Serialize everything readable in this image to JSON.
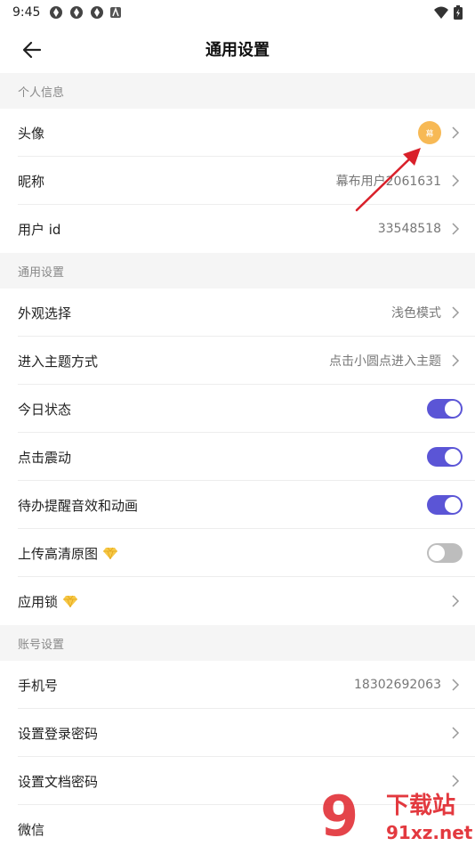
{
  "status_bar": {
    "time": "9:45"
  },
  "header": {
    "title": "通用设置"
  },
  "sections": {
    "personal": {
      "title": "个人信息",
      "avatar": {
        "label": "头像",
        "avatar_text": "幕"
      },
      "nickname": {
        "label": "昵称",
        "value": "幕布用户2061631"
      },
      "user_id": {
        "label": "用户 id",
        "value": "33548518"
      }
    },
    "general": {
      "title": "通用设置",
      "appearance": {
        "label": "外观选择",
        "value": "浅色模式"
      },
      "theme_entry": {
        "label": "进入主题方式",
        "value": "点击小圆点进入主题"
      },
      "today_status": {
        "label": "今日状态",
        "enabled": true
      },
      "tap_vibration": {
        "label": "点击震动",
        "enabled": true
      },
      "todo_reminder": {
        "label": "待办提醒音效和动画",
        "enabled": true
      },
      "upload_hd": {
        "label": "上传高清原图",
        "enabled": false,
        "premium_icon": "diamond-icon"
      },
      "app_lock": {
        "label": "应用锁",
        "premium_icon": "diamond-icon"
      }
    },
    "account": {
      "title": "账号设置",
      "phone": {
        "label": "手机号",
        "value": "18302692063"
      },
      "login_password": {
        "label": "设置登录密码"
      },
      "doc_password": {
        "label": "设置文档密码"
      },
      "wechat": {
        "label": "微信"
      }
    }
  },
  "watermark": {
    "text": "下载站",
    "domain": "91xz.net"
  },
  "colors": {
    "toggle_on": "#5b55d6",
    "toggle_off": "#bdbdbd",
    "avatar_bg": "#f7b955",
    "annotation_arrow": "#d9202a",
    "section_bg": "#f5f5f5"
  }
}
